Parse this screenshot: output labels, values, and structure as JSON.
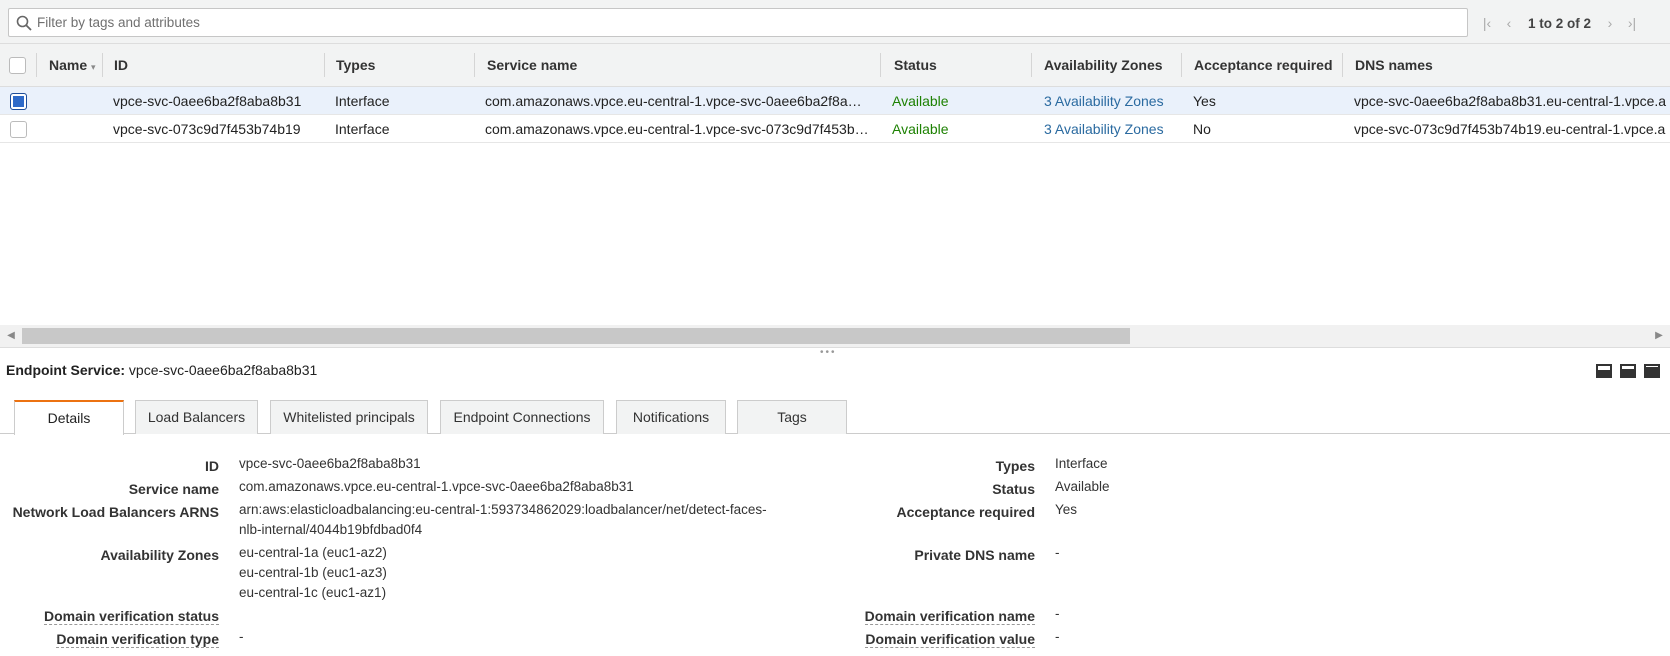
{
  "filter": {
    "placeholder": "Filter by tags and attributes"
  },
  "pagination": {
    "text": "1 to 2 of 2"
  },
  "table": {
    "columns": {
      "name": "Name",
      "id": "ID",
      "types": "Types",
      "service_name": "Service name",
      "status": "Status",
      "availability_zones": "Availability Zones",
      "acceptance_required": "Acceptance required",
      "dns_names": "DNS names"
    },
    "rows": [
      {
        "selected": true,
        "id": "vpce-svc-0aee6ba2f8aba8b31",
        "types": "Interface",
        "service_name": "com.amazonaws.vpce.eu-central-1.vpce-svc-0aee6ba2f8a…",
        "status": "Available",
        "availability_zones": "3 Availability Zones",
        "acceptance_required": "Yes",
        "dns_names": "vpce-svc-0aee6ba2f8aba8b31.eu-central-1.vpce.a"
      },
      {
        "selected": false,
        "id": "vpce-svc-073c9d7f453b74b19",
        "types": "Interface",
        "service_name": "com.amazonaws.vpce.eu-central-1.vpce-svc-073c9d7f453b…",
        "status": "Available",
        "availability_zones": "3 Availability Zones",
        "acceptance_required": "No",
        "dns_names": "vpce-svc-073c9d7f453b74b19.eu-central-1.vpce.a"
      }
    ]
  },
  "detail": {
    "title_label": "Endpoint Service:",
    "title_value": "vpce-svc-0aee6ba2f8aba8b31",
    "tabs": [
      "Details",
      "Load Balancers",
      "Whitelisted principals",
      "Endpoint Connections",
      "Notifications",
      "Tags"
    ],
    "active_tab": "Details",
    "left": {
      "id_label": "ID",
      "id_value": "vpce-svc-0aee6ba2f8aba8b31",
      "service_name_label": "Service name",
      "service_name_value": "com.amazonaws.vpce.eu-central-1.vpce-svc-0aee6ba2f8aba8b31",
      "nlb_label": "Network Load Balancers ARNS",
      "nlb_value_line1": "arn:aws:elasticloadbalancing:eu-central-1:593734862029:loadbalancer/net/detect-faces-",
      "nlb_value_line2": "nlb-internal/4044b19bfdbad0f4",
      "az_label": "Availability Zones",
      "az_values": [
        "eu-central-1a (euc1-az2)",
        "eu-central-1b (euc1-az3)",
        "eu-central-1c (euc1-az1)"
      ],
      "domain_status_label": "Domain verification status",
      "domain_status_value": "",
      "domain_type_label": "Domain verification type",
      "domain_type_value": "-"
    },
    "right": {
      "types_label": "Types",
      "types_value": "Interface",
      "status_label": "Status",
      "status_value": "Available",
      "acceptance_label": "Acceptance required",
      "acceptance_value": "Yes",
      "private_dns_label": "Private DNS name",
      "private_dns_value": "-",
      "domain_name_label": "Domain verification name",
      "domain_name_value": "-",
      "domain_value_label": "Domain verification value",
      "domain_value_value": "-"
    }
  },
  "colors": {
    "available": "#1d8102",
    "link": "#2a6aa0",
    "tab_accent": "#ec7211",
    "checkbox": "#2e6ac8"
  }
}
